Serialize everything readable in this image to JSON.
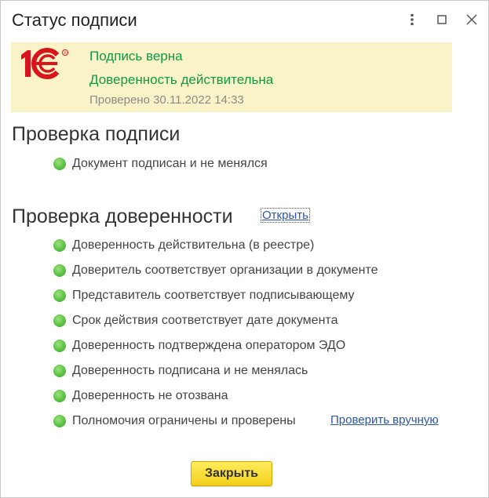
{
  "window": {
    "title": "Статус подписи",
    "controls": {
      "more": "more-icon",
      "maximize": "maximize-icon",
      "close": "close-icon"
    }
  },
  "status_panel": {
    "logo_text": "1С",
    "signature_status": "Подпись верна",
    "poa_status": "Доверенность действительна",
    "checked_at": "Проверено 30.11.2022 14:33",
    "colors": {
      "background": "#fbf3c8",
      "ok_text": "#0f9a44",
      "logo_red": "#d8151c"
    }
  },
  "signature_check": {
    "title": "Проверка подписи",
    "items": [
      "Документ подписан и не менялся"
    ]
  },
  "poa_check": {
    "title": "Проверка доверенности",
    "open_link": "Открыть",
    "items": [
      "Доверенность действительна (в реестре)",
      "Доверитель соответствует организации в документе",
      "Представитель соответствует подписывающему",
      "Срок действия соответствует дате документа",
      "Доверенность подтверждена оператором ЭДО",
      "Доверенность подписана и не менялась",
      "Доверенность не отозвана",
      "Полномочия ограничены и проверены"
    ],
    "manual_check_link": "Проверить вручную",
    "status_color": "#5cc244"
  },
  "footer": {
    "close_label": "Закрыть",
    "button_color": "#f3cf1b"
  }
}
